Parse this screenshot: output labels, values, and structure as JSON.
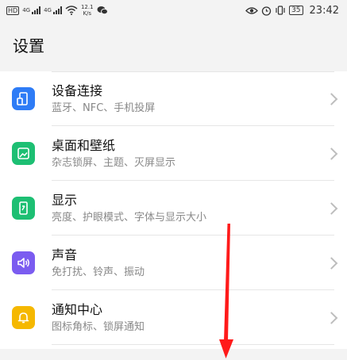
{
  "status_bar": {
    "hd_badge": "HD",
    "net_1": "4G",
    "net_2": "4G",
    "speed_value": "12.1",
    "speed_unit": "K/s",
    "battery": "35",
    "time": "23:42"
  },
  "header": {
    "title": "设置"
  },
  "settings": [
    {
      "label": "设备连接",
      "sub": "蓝牙、NFC、手机投屏",
      "icon": "device-connection-icon",
      "color": "#2e7cf6"
    },
    {
      "label": "桌面和壁纸",
      "sub": "杂志锁屏、主题、灭屏显示",
      "icon": "wallpaper-icon",
      "color": "#1dbf73"
    },
    {
      "label": "显示",
      "sub": "亮度、护眼模式、字体与显示大小",
      "icon": "display-icon",
      "color": "#1dbf73"
    },
    {
      "label": "声音",
      "sub": "免打扰、铃声、振动",
      "icon": "sound-icon",
      "color": "#7b5cf0"
    },
    {
      "label": "通知中心",
      "sub": "图标角标、锁屏通知",
      "icon": "notification-bell-icon",
      "color": "#f5b800"
    }
  ],
  "annotation": {
    "arrow_color": "#ff1a1a"
  }
}
